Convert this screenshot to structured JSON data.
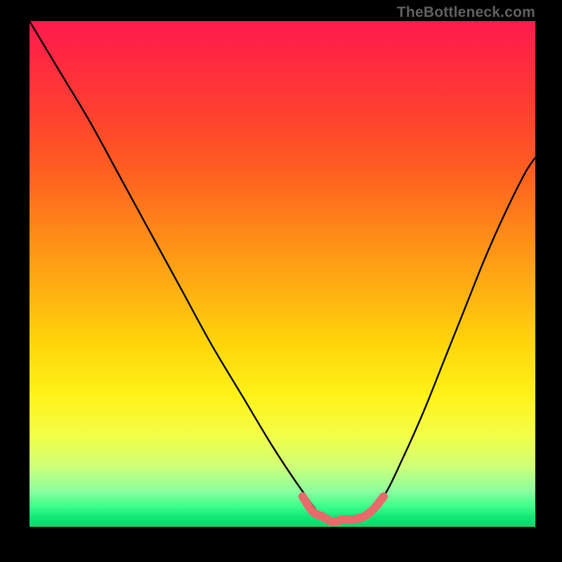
{
  "attribution": "TheBottleneck.com",
  "chart_data": {
    "type": "line",
    "title": "",
    "xlabel": "",
    "ylabel": "",
    "xlim": [
      0,
      100
    ],
    "ylim": [
      0,
      100
    ],
    "grid": false,
    "legend": false,
    "series": [
      {
        "name": "main-curve",
        "color": "#000000",
        "x": [
          0,
          6,
          12,
          18,
          24,
          30,
          36,
          42,
          48,
          54,
          58,
          62,
          66,
          70,
          74,
          78,
          82,
          86,
          90,
          94,
          98,
          100
        ],
        "y": [
          100,
          90,
          80,
          69,
          58,
          47,
          36,
          26,
          16,
          7,
          2,
          1,
          2,
          6,
          14,
          23,
          33,
          43,
          53,
          62,
          70,
          73
        ]
      },
      {
        "name": "bottom-highlight",
        "color": "#e86a6a",
        "x": [
          54,
          56,
          58,
          60,
          62,
          64,
          66,
          68,
          70
        ],
        "y": [
          6,
          3,
          2,
          1,
          1.5,
          1.5,
          2,
          3.5,
          6
        ]
      }
    ],
    "background_gradient": {
      "direction": "vertical",
      "stops": [
        {
          "pos": 0.0,
          "color": "#ff1a4d"
        },
        {
          "pos": 0.3,
          "color": "#ff6020"
        },
        {
          "pos": 0.64,
          "color": "#ffd60a"
        },
        {
          "pos": 0.88,
          "color": "#cfff78"
        },
        {
          "pos": 1.0,
          "color": "#0fd46d"
        }
      ]
    }
  }
}
